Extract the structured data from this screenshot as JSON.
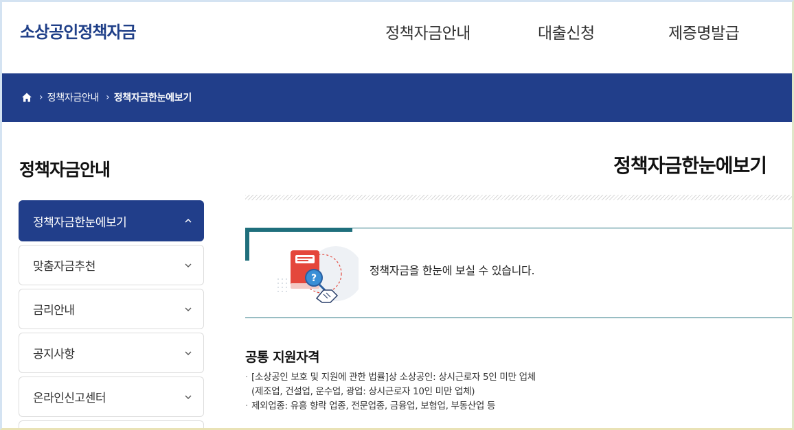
{
  "header": {
    "logo": "소상공인정책자금",
    "nav": [
      "정책자금안내",
      "대출신청",
      "제증명발급"
    ]
  },
  "breadcrumb": {
    "home_icon": "home-icon",
    "items": [
      "정책자금안내",
      "정책자금한눈에보기"
    ]
  },
  "sidebar": {
    "title": "정책자금안내",
    "items": [
      {
        "label": "정책자금한눈에보기",
        "active": true
      },
      {
        "label": "맞춤자금추천"
      },
      {
        "label": "금리안내"
      },
      {
        "label": "공지사항"
      },
      {
        "label": "온라인신고센터"
      }
    ]
  },
  "main": {
    "title": "정책자금한눈에보기",
    "intro_text": "정책자금을 한눈에 보실 수 있습니다.",
    "section_title": "공통 지원자격",
    "bullets": [
      {
        "line1": "[소상공인 보호 및 지원에 관한 법률]상 소상공인: 상시근로자 5인 미만 업체",
        "line2": "(제조업, 건설업, 운수업, 광업: 상시근로자 10인 미만 업체)"
      },
      {
        "line1": "제외업종: 유흥 향락 업종, 전문업종, 금융업, 보험업, 부동산업 등"
      }
    ]
  },
  "colors": {
    "brand": "#213e8a",
    "logo": "#1f3f88",
    "teal": "#1f6f7c"
  }
}
